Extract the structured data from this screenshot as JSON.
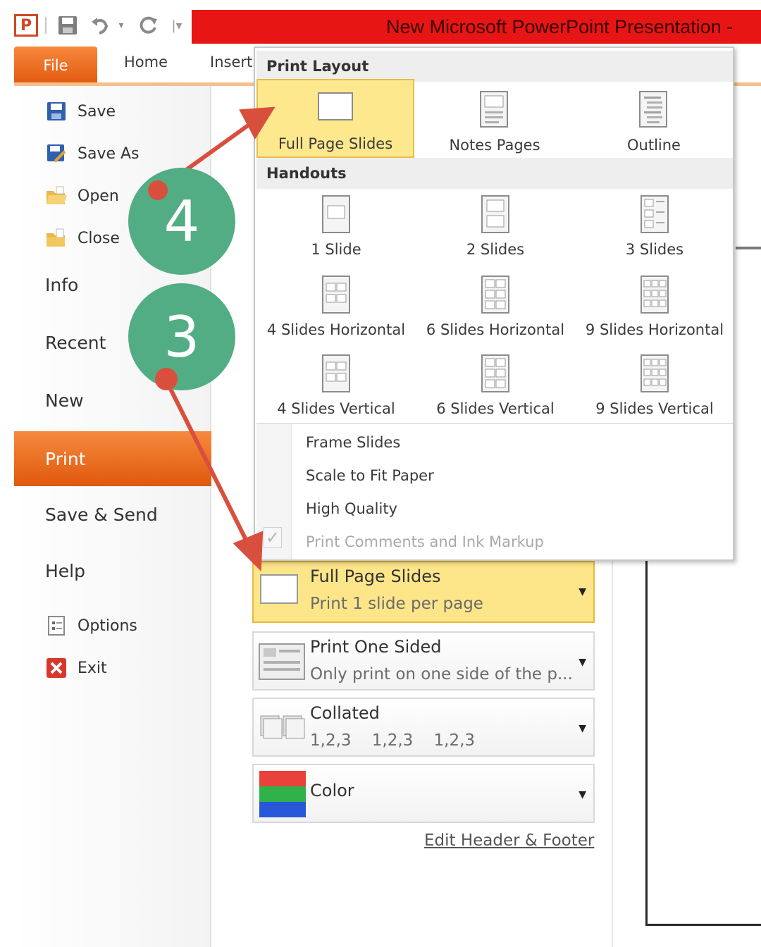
{
  "window": {
    "title": "New Microsoft PowerPoint Presentation  -"
  },
  "quick_access": {
    "logo": "P",
    "undo_arrow": "▾",
    "customize": "|▾"
  },
  "ribbon": {
    "tabs": [
      "File",
      "Home",
      "Insert"
    ]
  },
  "backstage_nav": {
    "commands": [
      "Save",
      "Save As",
      "Open",
      "Close"
    ],
    "items": [
      "Info",
      "Recent",
      "New",
      "Print",
      "Save & Send",
      "Help"
    ],
    "bottom_commands": [
      "Options",
      "Exit"
    ]
  },
  "popup": {
    "print_layout_header": "Print Layout",
    "layouts": [
      "Full Page Slides",
      "Notes Pages",
      "Outline"
    ],
    "handouts_header": "Handouts",
    "handouts": [
      "1 Slide",
      "2 Slides",
      "3 Slides",
      "4 Slides Horizontal",
      "6 Slides Horizontal",
      "9 Slides Horizontal",
      "4 Slides Vertical",
      "6 Slides Vertical",
      "9 Slides Vertical"
    ],
    "options": [
      "Frame Slides",
      "Scale to Fit Paper",
      "High Quality",
      "Print Comments and Ink Markup"
    ],
    "check": "✓"
  },
  "settings": {
    "layout_dd": {
      "title": "Full Page Slides",
      "subtitle": "Print 1 slide per page"
    },
    "sides_dd": {
      "title": "Print One Sided",
      "subtitle": "Only print on one side of the p..."
    },
    "collate_dd": {
      "title": "Collated",
      "subtitle": "1,2,3    1,2,3    1,2,3"
    },
    "color_dd": {
      "title": "Color"
    },
    "dropdown_arrow": "▼",
    "edit_header_footer": "Edit Header & Footer"
  },
  "annotations": {
    "step_4": "4",
    "step_3": "3"
  },
  "colors": {
    "title_bar": "#e81515",
    "file_tab": "#e8641a",
    "print_selected": "#e8641a",
    "highlight": "#fde68a",
    "callout": "#52ad84",
    "arrow": "#d94f3d"
  }
}
